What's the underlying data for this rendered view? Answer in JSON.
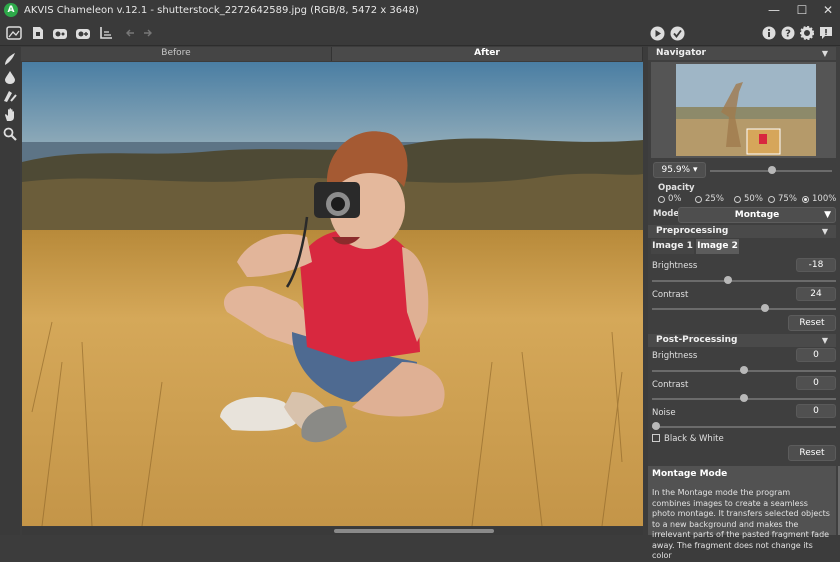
{
  "titlebar": {
    "logo": "A",
    "title": "AKVIS Chameleon v.12.1 - shutterstock_2272642589.jpg (RGB/8, 5472 x 3648)",
    "minimize": "—",
    "maximize": "☐",
    "close": "✕"
  },
  "toolbar": {
    "icons": [
      "open-image-icon",
      "save-icon",
      "import-icon",
      "export-icon",
      "print-icon",
      "undo-icon",
      "redo-icon",
      "run-icon",
      "apply-icon",
      "info-icon",
      "help-icon",
      "settings-icon",
      "news-icon"
    ]
  },
  "left_tools": [
    "brush-icon",
    "drop-icon",
    "eraser-brush-icon",
    "hand-icon",
    "zoom-icon"
  ],
  "view_tabs": {
    "before": "Before",
    "after": "After"
  },
  "navigator": {
    "header": "Navigator",
    "zoom": "95.9%"
  },
  "opacity": {
    "label": "Opacity",
    "options": [
      "0%",
      "25%",
      "50%",
      "75%",
      "100%"
    ],
    "selected": "100%"
  },
  "mode": {
    "label": "Mode",
    "value": "Montage"
  },
  "preprocessing": {
    "header": "Preprocessing",
    "tabs": [
      "Image 1",
      "Image 2"
    ],
    "active_tab": "Image 2",
    "brightness_label": "Brightness",
    "brightness_value": "-18",
    "brightness_pos": 0.41,
    "contrast_label": "Contrast",
    "contrast_value": "24",
    "contrast_pos": 0.62,
    "reset": "Reset"
  },
  "postprocessing": {
    "header": "Post-Processing",
    "brightness_label": "Brightness",
    "brightness_value": "0",
    "brightness_pos": 0.5,
    "contrast_label": "Contrast",
    "contrast_value": "0",
    "contrast_pos": 0.5,
    "noise_label": "Noise",
    "noise_value": "0",
    "noise_pos": 0.0,
    "bw_label": "Black & White",
    "reset": "Reset"
  },
  "help": {
    "title": "Montage Mode",
    "text": "In the Montage mode the program combines images to create a seamless photo montage. It transfers selected objects to a new background and makes the irrelevant parts of the pasted fragment fade away. The fragment does not change its color"
  },
  "colors": {
    "accent_green": "#2eaa4a",
    "panel_bg": "#3f3f3f",
    "section_bg": "#4a4a4a"
  }
}
